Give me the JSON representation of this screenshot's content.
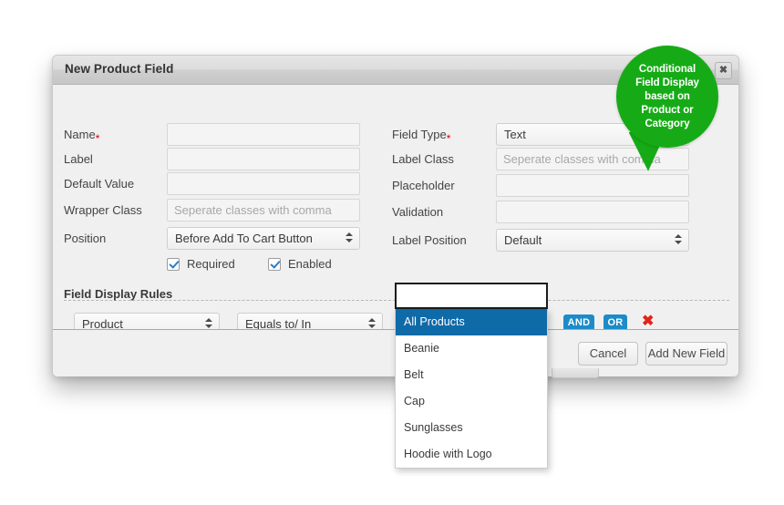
{
  "modal": {
    "title": "New Product Field",
    "close_label": "✖"
  },
  "form": {
    "left_column": [
      {
        "label": "Name",
        "required": true,
        "type": "text",
        "value": "",
        "placeholder": ""
      },
      {
        "label": "Label",
        "required": false,
        "type": "text",
        "value": "",
        "placeholder": ""
      },
      {
        "label": "Default Value",
        "required": false,
        "type": "text",
        "value": "",
        "placeholder": ""
      },
      {
        "label": "Wrapper Class",
        "required": false,
        "type": "text",
        "value": "",
        "placeholder": "Seperate classes with comma"
      },
      {
        "label": "Position",
        "required": false,
        "type": "select",
        "value": "Before Add To Cart Button",
        "placeholder": ""
      }
    ],
    "right_column": [
      {
        "label": "Field Type",
        "required": true,
        "type": "select",
        "value": "Text",
        "placeholder": ""
      },
      {
        "label": "Label Class",
        "required": false,
        "type": "text",
        "value": "",
        "placeholder": "Seperate classes with comma"
      },
      {
        "label": "Placeholder",
        "required": false,
        "type": "text",
        "value": "",
        "placeholder": ""
      },
      {
        "label": "Validation",
        "required": false,
        "type": "text",
        "value": "",
        "placeholder": ""
      },
      {
        "label": "Label Position",
        "required": false,
        "type": "select",
        "value": "Default",
        "placeholder": ""
      }
    ],
    "checkboxes": [
      {
        "label": "Required",
        "checked": true
      },
      {
        "label": "Enabled",
        "checked": true
      }
    ],
    "required_marker": "*"
  },
  "field_display_rules": {
    "heading": "Field Display Rules",
    "rule": {
      "subject": "Product",
      "operator": "Equals to/ In",
      "value_input": "",
      "and_label": "AND",
      "or_label": "OR",
      "delete_label": "✖"
    },
    "dropdown_options": [
      "All Products",
      "Beanie",
      "Belt",
      "Cap",
      "Sunglasses",
      "Hoodie with Logo"
    ],
    "dropdown_selected_index": 0
  },
  "footer": {
    "cancel_label": "Cancel",
    "submit_label": "Add New Field"
  },
  "callout": {
    "lines": [
      "Conditional",
      "Field Display",
      "based on",
      "Product or",
      "Category"
    ],
    "color": "#16ab16"
  },
  "colors": {
    "accent_blue": "#1e8bc9",
    "selection_blue": "#0f6aa8",
    "danger_red": "#e2231a",
    "callout_green": "#16ab16",
    "modal_bg": "#f0f0f0"
  }
}
